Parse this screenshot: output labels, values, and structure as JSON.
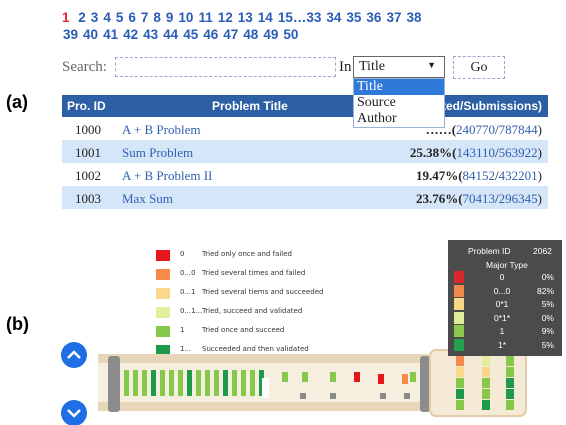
{
  "panel_labels": {
    "a": "(a)",
    "b": "(b)"
  },
  "pager": {
    "current": "1",
    "row1": [
      "2",
      "3",
      "4",
      "5",
      "6",
      "7",
      "8",
      "9",
      "10",
      "11",
      "12",
      "13",
      "14",
      "15…33",
      "34",
      "35",
      "36",
      "37",
      "38"
    ],
    "row2": [
      "39",
      "40",
      "41",
      "42",
      "43",
      "44",
      "45",
      "46",
      "47",
      "48",
      "49",
      "50"
    ]
  },
  "search": {
    "label": "Search:",
    "value": "",
    "in_label": "In",
    "selected": "Title",
    "options": [
      "Title",
      "Source",
      "Author"
    ],
    "go_label": "Go"
  },
  "table": {
    "headers": [
      "Pro. ID",
      "Problem Title",
      "ted/Submissions)"
    ],
    "rows": [
      {
        "id": "1000",
        "title": "A + B Problem",
        "pct": "……(",
        "accepted": "240770",
        "submissions": "787844"
      },
      {
        "id": "1001",
        "title": "Sum Problem",
        "pct": "25.38%(",
        "accepted": "143110",
        "submissions": "563922"
      },
      {
        "id": "1002",
        "title": "A + B Problem II",
        "pct": "19.47%(",
        "accepted": "84152",
        "submissions": "432201"
      },
      {
        "id": "1003",
        "title": "Max Sum",
        "pct": "23.76%(",
        "accepted": "70413",
        "submissions": "296345"
      }
    ]
  },
  "legend": [
    {
      "color": "#e6161b",
      "symbol": "0",
      "text": "Tried only once and failed"
    },
    {
      "color": "#f58a4a",
      "symbol": "0...0",
      "text": "Tried several times and failed"
    },
    {
      "color": "#fad78a",
      "symbol": "0...1",
      "text": "Tried several tiems and succeeded"
    },
    {
      "color": "#e1ef9c",
      "symbol": "0...1...",
      "text": "Tried, succeed and validated"
    },
    {
      "color": "#86c94a",
      "symbol": "1",
      "text": "Tried once and succeed"
    },
    {
      "color": "#1f9a4a",
      "symbol": "1...",
      "text": "Succeeded and then validated"
    }
  ],
  "tooltip": {
    "problem_label": "Problem ID",
    "problem_id": "2062",
    "major_label": "Major Type",
    "rows": [
      {
        "color": "#d8282b",
        "label": "0",
        "value": "0%"
      },
      {
        "color": "#f08a4a",
        "label": "0...0",
        "value": "82%"
      },
      {
        "color": "#f7d886",
        "label": "0*1",
        "value": "5%"
      },
      {
        "color": "#e0ee9c",
        "label": "0*1*",
        "value": "0%"
      },
      {
        "color": "#8cc850",
        "label": "1",
        "value": "9%"
      },
      {
        "color": "#24a04e",
        "label": "1*",
        "value": "5%"
      }
    ]
  },
  "colors": {
    "accent": "#2c5fa3",
    "link": "#3160b0",
    "button": "#1e6fe6",
    "tooltip_bg": "#4b4b4b"
  },
  "icons": {
    "up": "chevron-up-icon",
    "down": "chevron-down-icon"
  }
}
